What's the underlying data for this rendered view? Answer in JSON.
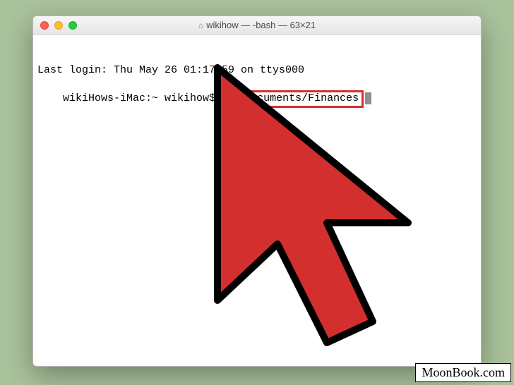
{
  "window": {
    "title": "wikihow — -bash — 63×21",
    "home_icon": "⌂"
  },
  "terminal": {
    "line1": "Last login: Thu May 26 01:17:59 on ttys000",
    "line2_prompt": "wikiHows-iMac:~ wikihow$ ",
    "line2_command": "cd Documents/Finances"
  },
  "watermark": "MoonBook.com",
  "cursor_arrow": {
    "fill": "#d32f2f",
    "stroke": "#000000"
  }
}
